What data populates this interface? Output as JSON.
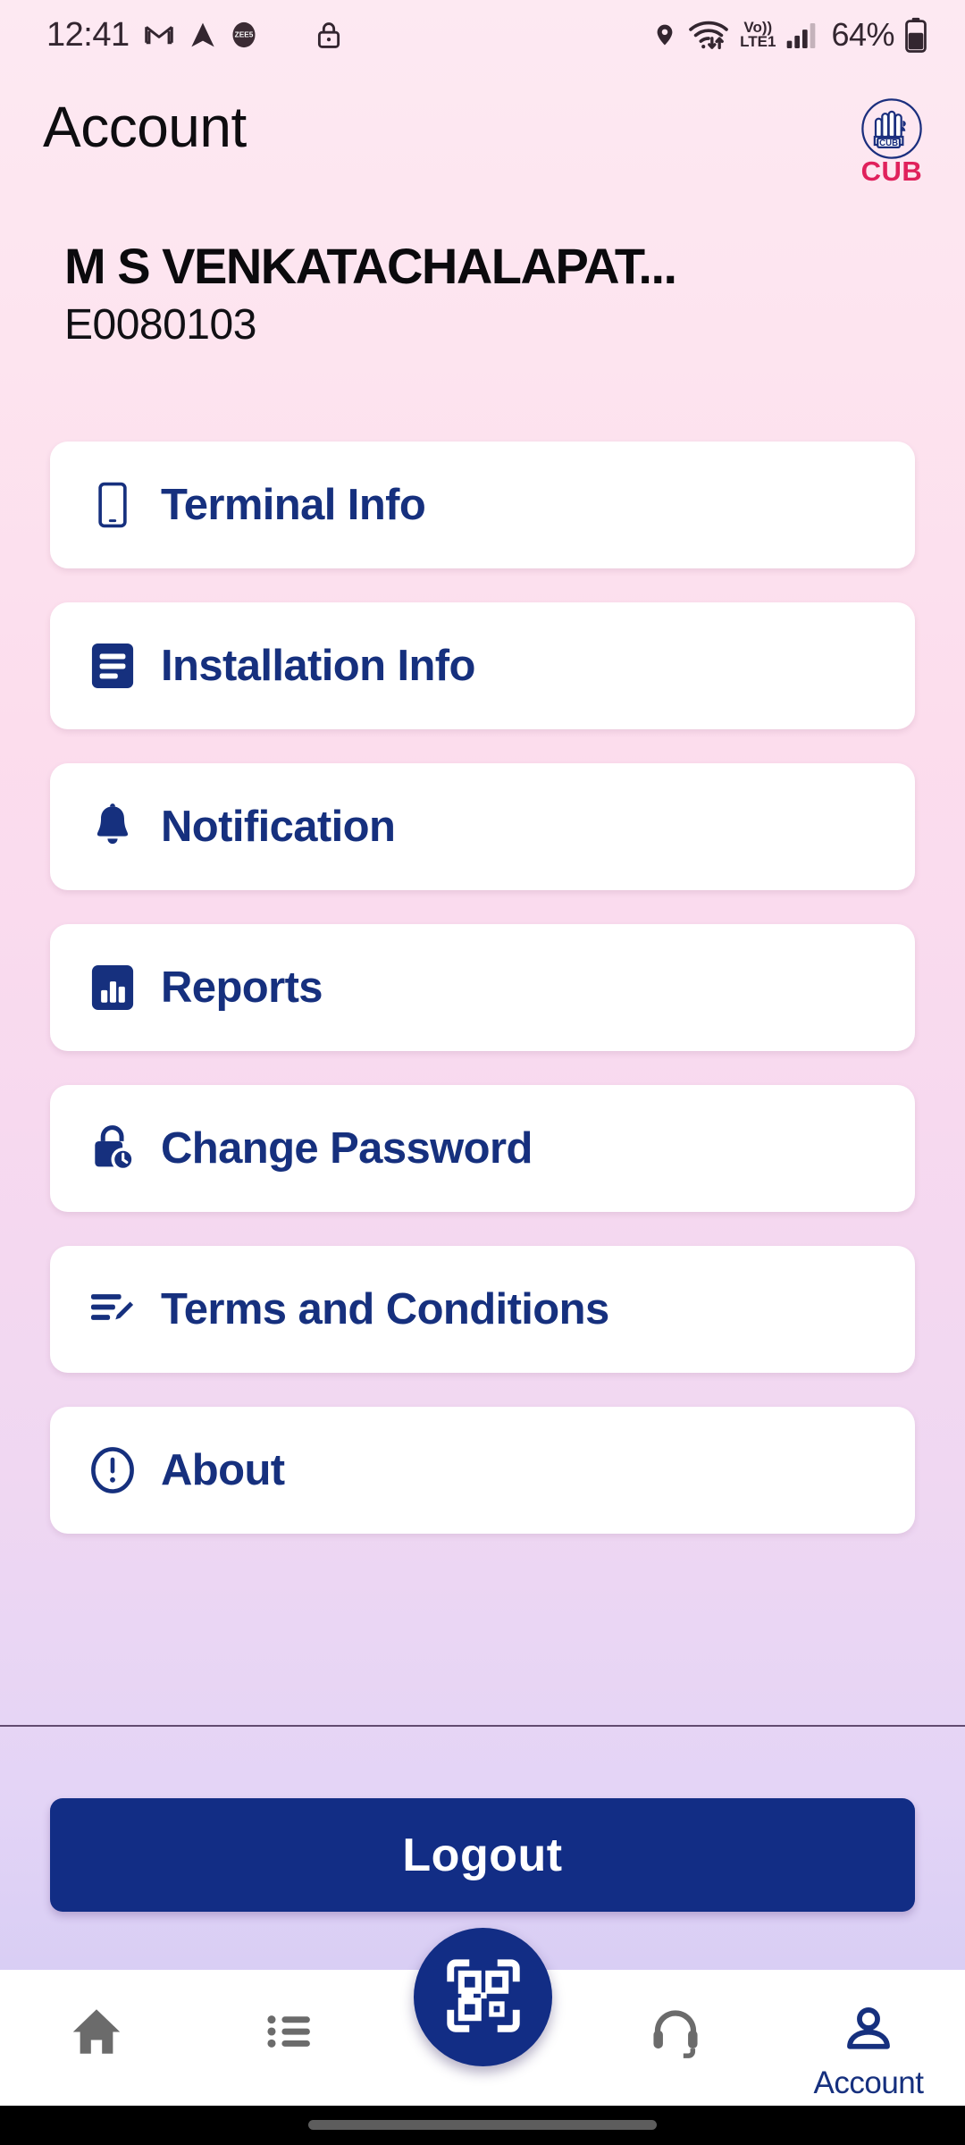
{
  "status_bar": {
    "time": "12:41",
    "battery_percent": "64%",
    "network_label_top": "Vo))",
    "network_label_bottom": "LTE1",
    "icons": [
      "gmail-icon",
      "navigation-arrow-icon",
      "zee5-icon",
      "lock-icon",
      "location-pin-icon",
      "wifi-icon",
      "volte-icon",
      "cellular-signal-icon",
      "battery-icon"
    ]
  },
  "header": {
    "title": "Account",
    "brand_name": "CUB",
    "brand_mark_text": "CUB"
  },
  "user": {
    "name": "M S VENKATACHALAPAT...",
    "id": "E0080103"
  },
  "menu": {
    "items": [
      {
        "label": "Terminal Info",
        "icon": "smartphone-icon"
      },
      {
        "label": "Installation Info",
        "icon": "document-lines-icon"
      },
      {
        "label": "Notification",
        "icon": "bell-icon"
      },
      {
        "label": "Reports",
        "icon": "bar-chart-icon"
      },
      {
        "label": "Change Password",
        "icon": "lock-clock-icon"
      },
      {
        "label": "Terms and Conditions",
        "icon": "document-edit-icon"
      },
      {
        "label": "About",
        "icon": "exclamation-circle-icon"
      }
    ]
  },
  "logout": {
    "label": "Logout"
  },
  "bottom_nav": {
    "items": [
      {
        "label": "",
        "icon": "home-icon",
        "active": false
      },
      {
        "label": "",
        "icon": "list-icon",
        "active": false
      },
      {
        "label": "",
        "icon": "qr-scan-icon",
        "active": false
      },
      {
        "label": "",
        "icon": "headset-icon",
        "active": false
      },
      {
        "label": "Account",
        "icon": "person-icon",
        "active": true
      }
    ]
  },
  "colors": {
    "primary_navy": "#122d85",
    "label_navy": "#16307e",
    "brand_pink": "#e0215c",
    "card_white": "#ffffff",
    "inactive_gray": "#6b6b6b"
  }
}
